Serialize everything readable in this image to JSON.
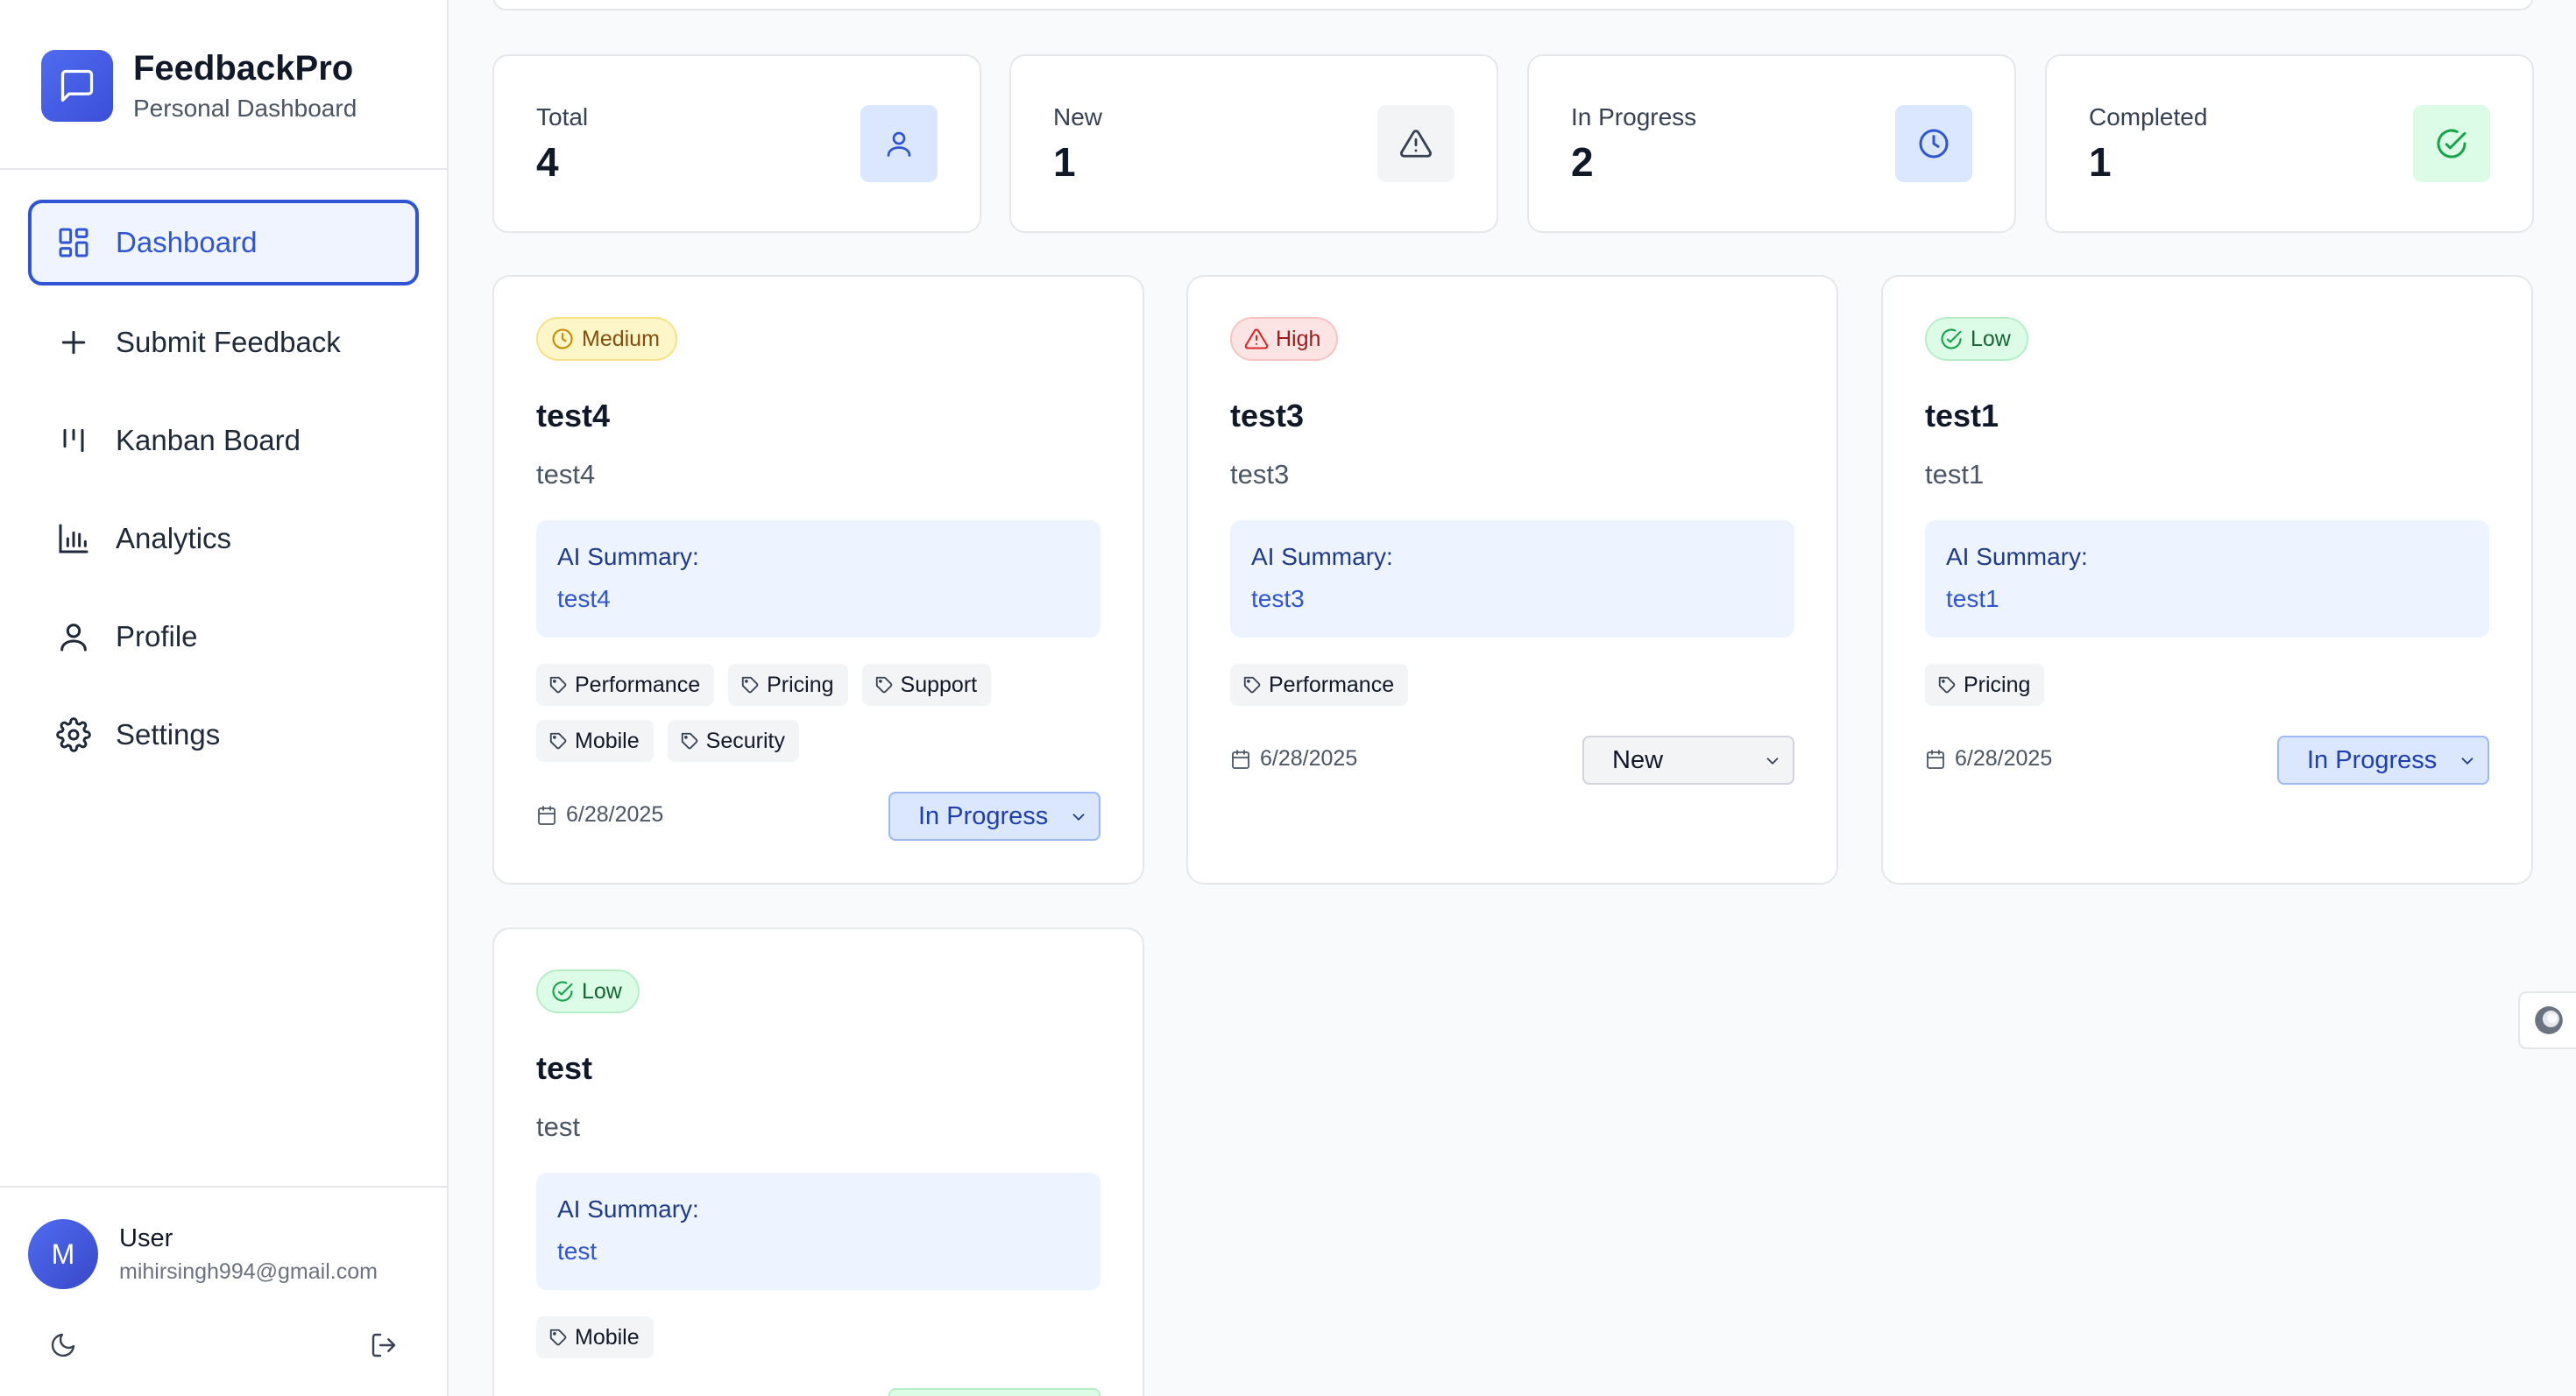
{
  "brand": {
    "name": "FeedbackPro",
    "subtitle": "Personal Dashboard"
  },
  "nav": [
    {
      "label": "Dashboard",
      "icon": "grid-icon",
      "active": true
    },
    {
      "label": "Submit Feedback",
      "icon": "plus-icon"
    },
    {
      "label": "Kanban Board",
      "icon": "kanban-icon"
    },
    {
      "label": "Analytics",
      "icon": "bar-chart-icon"
    },
    {
      "label": "Profile",
      "icon": "user-icon"
    },
    {
      "label": "Settings",
      "icon": "gear-icon"
    }
  ],
  "user": {
    "initial": "M",
    "name": "User",
    "email": "mihirsingh994@gmail.com"
  },
  "stats": [
    {
      "label": "Total",
      "value": "4",
      "icon": "user-icon",
      "color": "#2f55d4",
      "bg": "#dbe7fe"
    },
    {
      "label": "New",
      "value": "1",
      "icon": "alert-triangle-icon",
      "color": "#374151",
      "bg": "#f3f4f6"
    },
    {
      "label": "In Progress",
      "value": "2",
      "icon": "clock-icon",
      "color": "#2f55d4",
      "bg": "#dbe7fe"
    },
    {
      "label": "Completed",
      "value": "1",
      "icon": "check-circle-icon",
      "color": "#16a34a",
      "bg": "#dcfce7"
    }
  ],
  "feedback": [
    {
      "priority": "Medium",
      "title": "test4",
      "description": "test4",
      "ai_label": "AI Summary:",
      "ai_summary": "test4",
      "tags": [
        "Performance",
        "Pricing",
        "Support",
        "Mobile",
        "Security"
      ],
      "date": "6/28/2025",
      "status": "In Progress"
    },
    {
      "priority": "High",
      "title": "test3",
      "description": "test3",
      "ai_label": "AI Summary:",
      "ai_summary": "test3",
      "tags": [
        "Performance"
      ],
      "date": "6/28/2025",
      "status": "New"
    },
    {
      "priority": "Low",
      "title": "test1",
      "description": "test1",
      "ai_label": "AI Summary:",
      "ai_summary": "test1",
      "tags": [
        "Pricing"
      ],
      "date": "6/28/2025",
      "status": "In Progress"
    },
    {
      "priority": "Low",
      "title": "test",
      "description": "test",
      "ai_label": "AI Summary:",
      "ai_summary": "test",
      "tags": [
        "Mobile"
      ]
    }
  ]
}
